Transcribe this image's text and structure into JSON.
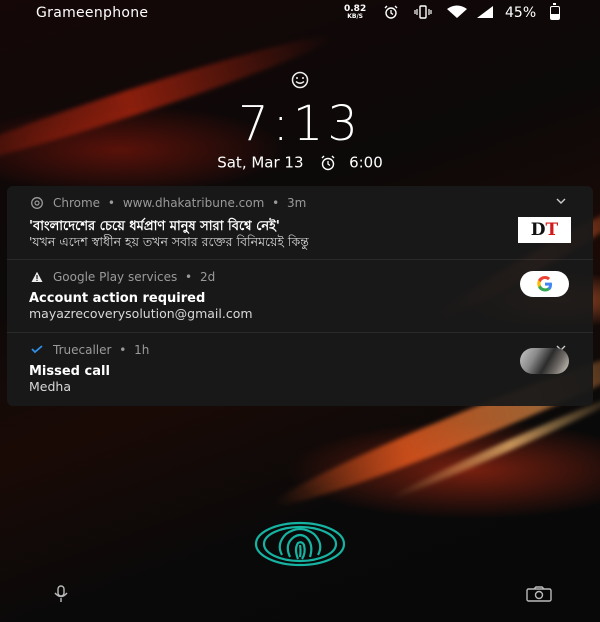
{
  "status_bar": {
    "carrier": "Grameenphone",
    "net_speed_value": "0.82",
    "net_speed_unit": "KB/S",
    "battery_percent": "45%",
    "battery_level": 0.45,
    "icons": [
      "alarm-icon",
      "vibrate-icon",
      "wifi-icon",
      "signal-icon",
      "battery-icon"
    ]
  },
  "lock": {
    "face_unlock_icon": "smile-icon",
    "time": "7:13",
    "date": "Sat, Mar 13",
    "alarm_time": "6:00"
  },
  "notifications": [
    {
      "app": "Chrome",
      "source": "www.dhakatribune.com",
      "age": "3m",
      "title": "'বাংলাদেশের চেয়ে ধর্মপ্রাণ মানুষ সারা বিশ্বে নেই'",
      "body": "'যখন এদেশ স্বাধীন হয় তখন সবার রক্তের বিনিময়েই কিন্তু",
      "thumb_text_1": "D",
      "thumb_text_2": "T",
      "app_icon": "chrome-icon"
    },
    {
      "app": "Google Play services",
      "age": "2d",
      "title": "Account action required",
      "body": "mayazrecoverysolution@gmail.com",
      "app_icon": "warning-icon"
    },
    {
      "app": "Truecaller",
      "age": "1h",
      "title": "Missed call",
      "body": "Medha",
      "app_icon": "truecaller-icon"
    }
  ],
  "separator": "•",
  "bottom": {
    "left_icon": "microphone-icon",
    "center_icon": "fingerprint-icon",
    "right_icon": "camera-icon",
    "fingerprint_color": "#16b3a2"
  }
}
